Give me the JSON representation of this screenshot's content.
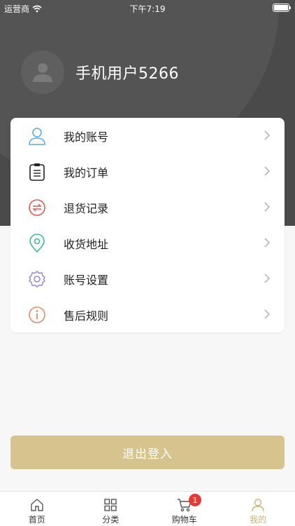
{
  "status_bar": {
    "carrier": "运营商",
    "time": "下午7:19"
  },
  "profile": {
    "username": "手机用户5266"
  },
  "menu": {
    "items": [
      {
        "label": "我的账号",
        "icon": "user-icon",
        "color": "#5aaee0"
      },
      {
        "label": "我的订单",
        "icon": "clipboard-icon",
        "color": "#222222"
      },
      {
        "label": "退货记录",
        "icon": "return-icon",
        "color": "#e0584e"
      },
      {
        "label": "收货地址",
        "icon": "location-pin-icon",
        "color": "#3dbd8f"
      },
      {
        "label": "账号设置",
        "icon": "gear-icon",
        "color": "#9a86d6"
      },
      {
        "label": "售后规则",
        "icon": "info-icon",
        "color": "#e08a66"
      }
    ]
  },
  "logout_label": "退出登入",
  "tabbar": {
    "tabs": [
      {
        "label": "首页",
        "icon": "home-icon"
      },
      {
        "label": "分类",
        "icon": "grid-icon"
      },
      {
        "label": "购物车",
        "icon": "cart-icon",
        "badge": "1"
      },
      {
        "label": "我的",
        "icon": "user-icon",
        "active": true
      }
    ]
  },
  "colors": {
    "accent": "#d6c38d",
    "header": "#4a4a4a",
    "badge": "#e53935"
  }
}
